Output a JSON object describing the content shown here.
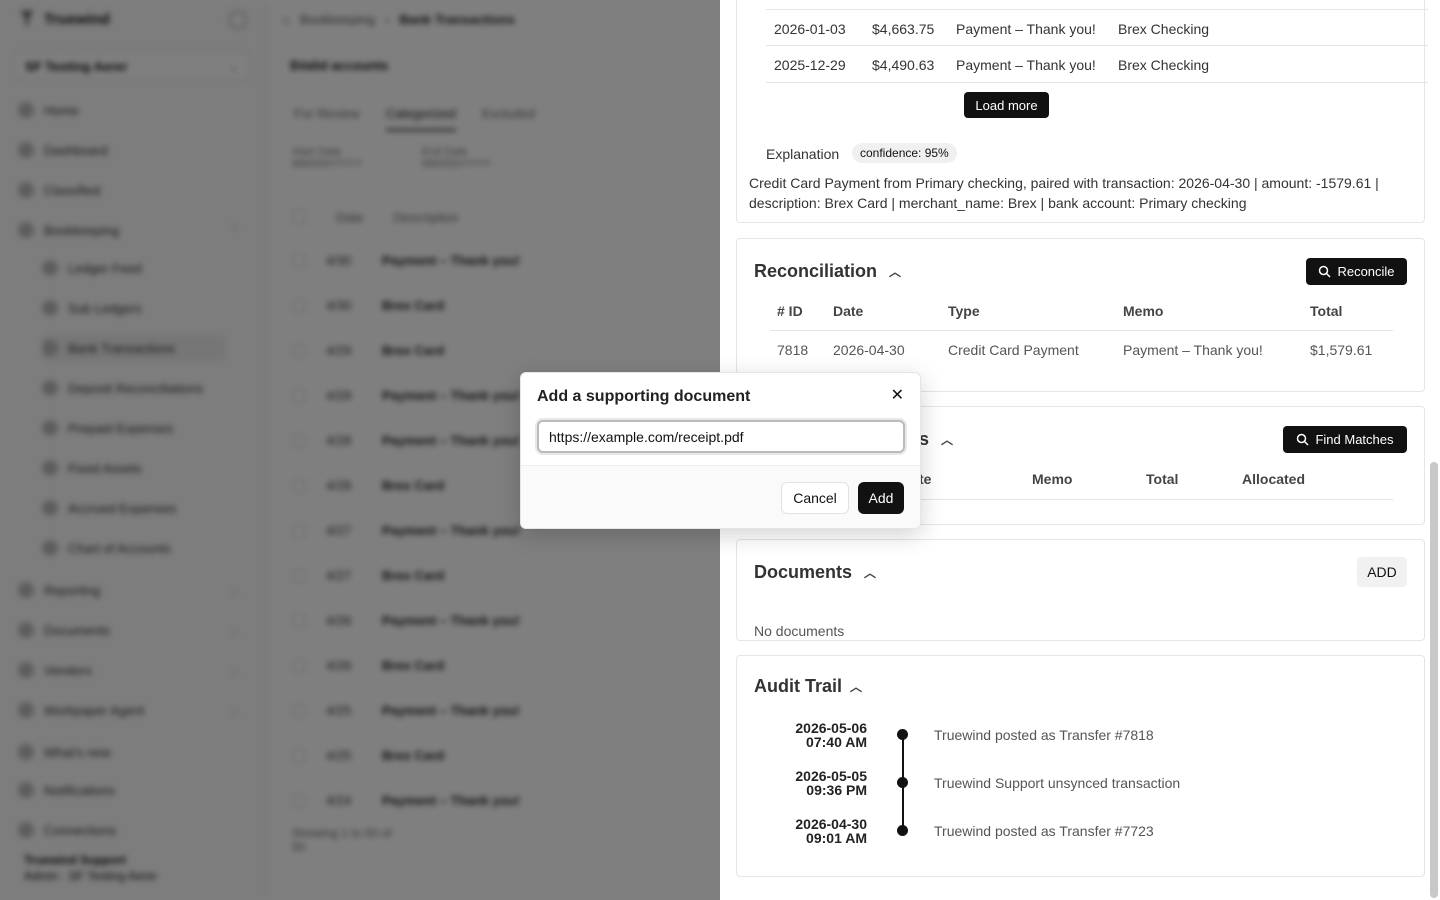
{
  "sidebar": {
    "brand": "Truewind",
    "org": "SF Testing Aerer",
    "items": [
      {
        "label": "Home"
      },
      {
        "label": "Dashboard"
      },
      {
        "label": "Classified"
      },
      {
        "label": "Bookkeeping"
      },
      {
        "label": "Reporting"
      },
      {
        "label": "Documents"
      },
      {
        "label": "Vendors"
      },
      {
        "label": "Workpaper Agent"
      },
      {
        "label": "What's new"
      },
      {
        "label": "Notifications"
      },
      {
        "label": "Connections"
      }
    ],
    "sub_items": [
      {
        "label": "Ledger Feed"
      },
      {
        "label": "Sub Ledgers"
      },
      {
        "label": "Bank Transactions"
      },
      {
        "label": "Deposit Reconciliations"
      },
      {
        "label": "Prepaid Expenses"
      },
      {
        "label": "Fixed Assets"
      },
      {
        "label": "Accrued Expenses"
      },
      {
        "label": "Chart of Accounts"
      }
    ],
    "user": {
      "name": "Truewind Support",
      "role": "Admin · SF Testing Aerer"
    }
  },
  "main": {
    "breadcrumb": [
      "Bookkeeping",
      "Bank Transactions"
    ],
    "account_title": "$Valid accounts",
    "tabs": [
      "For Review",
      "Categorized",
      "Excluded"
    ],
    "filters": [
      {
        "label": "Start Date",
        "value": "MM/DD/YYYY"
      },
      {
        "label": "End Date",
        "value": "MM/DD/YYYY"
      }
    ],
    "columns": [
      "Date",
      "Description"
    ],
    "rows": [
      {
        "date": "4/30",
        "desc": "Payment – Thank you!"
      },
      {
        "date": "4/30",
        "desc": "Brex Card"
      },
      {
        "date": "4/29",
        "desc": "Brex Card"
      },
      {
        "date": "4/29",
        "desc": "Payment – Thank you!"
      },
      {
        "date": "4/28",
        "desc": "Payment – Thank you!"
      },
      {
        "date": "4/28",
        "desc": "Brex Card"
      },
      {
        "date": "4/27",
        "desc": "Payment – Thank you!"
      },
      {
        "date": "4/27",
        "desc": "Brex Card"
      },
      {
        "date": "4/26",
        "desc": "Payment – Thank you!"
      },
      {
        "date": "4/26",
        "desc": "Brex Card"
      },
      {
        "date": "4/25",
        "desc": "Payment – Thank you!"
      },
      {
        "date": "4/25",
        "desc": "Brex Card"
      },
      {
        "date": "4/24",
        "desc": "Payment – Thank you!"
      }
    ],
    "footer": "Showing 1 to 50 of",
    "footer_sub": "50"
  },
  "panel": {
    "transactions": [
      {
        "date": "2026-01-03",
        "amount": "$4,663.75",
        "desc": "Payment – Thank you!",
        "account": "Brex Checking"
      },
      {
        "date": "2025-12-29",
        "amount": "$4,490.63",
        "desc": "Payment – Thank you!",
        "account": "Brex Checking"
      }
    ],
    "load_more": "Load more",
    "explanation_label": "Explanation",
    "confidence": "confidence: 95%",
    "explanation": "Credit Card Payment from Primary checking, paired with transaction: 2026-04-30 | amount: -1579.61 | description: Brex Card | merchant_name: Brex | bank account: Primary checking",
    "reconciliation": {
      "title": "Reconciliation",
      "button": "Reconcile",
      "columns": [
        "# ID",
        "Date",
        "Type",
        "Memo",
        "Total"
      ],
      "row": {
        "id": "7818",
        "date": "2026-04-30",
        "type": "Credit Card Payment",
        "memo": "Payment – Thank you!",
        "total": "$1,579.61"
      }
    },
    "matches": {
      "title_fragment": "s",
      "button": "Find Matches",
      "columns": [
        "te",
        "Memo",
        "Total",
        "Allocated"
      ]
    },
    "documents": {
      "title": "Documents",
      "button": "ADD",
      "empty": "No documents"
    },
    "audit": {
      "title": "Audit Trail",
      "entries": [
        {
          "date": "2026-05-06",
          "time": "07:40 AM",
          "text": "Truewind posted as Transfer #7818"
        },
        {
          "date": "2026-05-05",
          "time": "09:36 PM",
          "text": "Truewind Support unsynced transaction"
        },
        {
          "date": "2026-04-30",
          "time": "09:01 AM",
          "text": "Truewind posted as Transfer #7723"
        }
      ]
    }
  },
  "modal": {
    "title": "Add a supporting document",
    "input_value": "https://example.com/receipt.pdf",
    "cancel": "Cancel",
    "add": "Add"
  }
}
